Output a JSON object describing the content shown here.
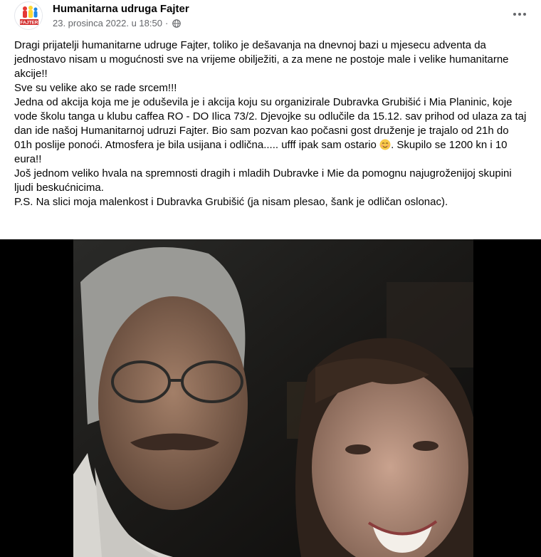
{
  "post": {
    "author": "Humanitarna udruga Fajter",
    "avatar_text": "FAJTER",
    "timestamp": "23. prosinca 2022. u 18:50",
    "separator": "·",
    "privacy_icon": "globe-icon",
    "more_icon": "more-options-icon",
    "paragraphs": [
      "Dragi prijatelji humanitarne udruge Fajter, toliko je dešavanja na dnevnoj bazi u mjesecu adventa da jednostavo nisam u mogućnosti sve na vrijeme obilježiti, a za mene ne postoje male i velike humanitarne akcije!!",
      "Sve su velike ako se rade srcem!!!",
      "Jedna od akcija koja me je oduševila je i akcija koju su organizirale Dubravka Grubišić i Mia Planinic, koje vode školu tanga u klubu caffea RO - DO Ilica 73/2. Djevojke su odlučile da 15.12. sav prihod od ulaza za taj dan ide našoj Humanitarnoj udruzi Fajter. Bio sam pozvan kao počasni gost druženje je trajalo od 21h do 01h poslije ponoći. Atmosfera je bila usijana i odlična..... ufff ipak sam ostario",
      "Još jednom veliko hvala na spremnosti dragih i mladih Dubravke i Mie da pomognu najugroženijoj skupini ljudi beskućnicima.",
      "P.S. Na slici moja malenkost i Dubravka Grubišić (ja nisam plesao, šank je odličan oslonac)."
    ],
    "after_emoji": ". Skupilo se 1200 kn i 10 eura!!",
    "emoji_icon": "smiling-face-emoji-icon"
  },
  "colors": {
    "text": "#050505",
    "meta": "#65676b",
    "photo_bg": "#000000"
  }
}
